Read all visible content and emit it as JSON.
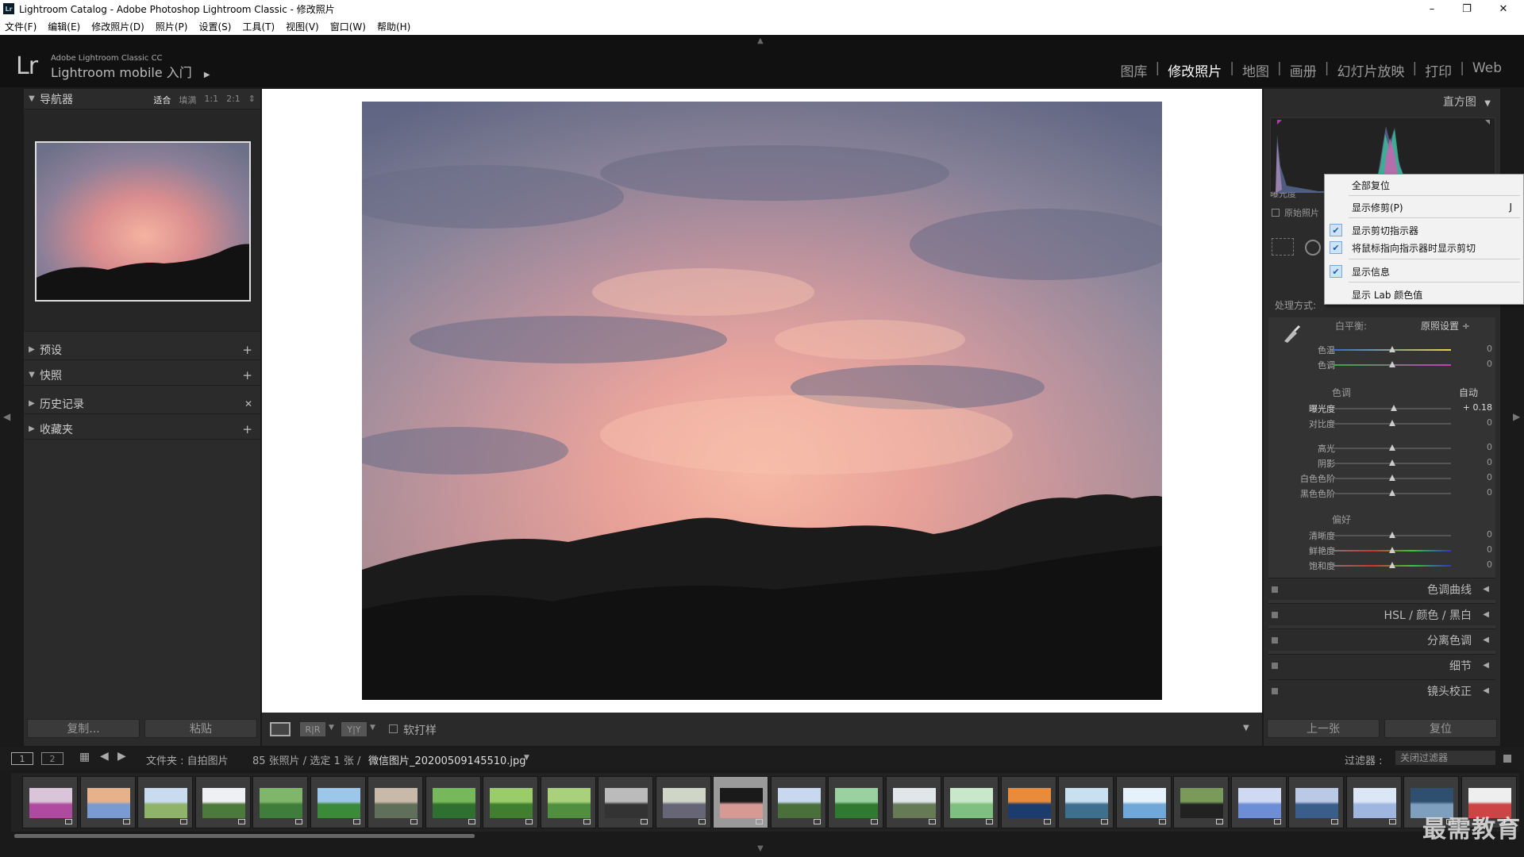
{
  "window": {
    "title": "Lightroom Catalog - Adobe Photoshop Lightroom Classic - 修改照片",
    "badge": "Lr",
    "minimize": "–",
    "restore": "❐",
    "close": "✕"
  },
  "menu": [
    "文件(F)",
    "编辑(E)",
    "修改照片(D)",
    "照片(P)",
    "设置(S)",
    "工具(T)",
    "视图(V)",
    "窗口(W)",
    "帮助(H)"
  ],
  "identity": {
    "logo": "Lr",
    "line1": "Adobe Lightroom Classic CC",
    "line2": "Lightroom mobile 入门",
    "arrow": "▶"
  },
  "modules": {
    "items": [
      "图库",
      "修改照片",
      "地图",
      "画册",
      "幻灯片放映",
      "打印",
      "Web"
    ],
    "active": "修改照片",
    "separator": "|"
  },
  "left_panel": {
    "navigator": {
      "title": "导航器",
      "options": [
        "适合",
        "填满",
        "1:1",
        "2:1"
      ],
      "selected": "适合",
      "spin": "⇕"
    },
    "sections": [
      {
        "title": "预设",
        "action": "+"
      },
      {
        "title": "快照",
        "action": "+"
      },
      {
        "title": "历史记录",
        "action": "✕"
      },
      {
        "title": "收藏夹",
        "action": "+"
      }
    ],
    "copy_button": "复制...",
    "paste_button": "粘贴"
  },
  "toolbar": {
    "soft_proof": "软打样",
    "view_before_after_1": "R|R",
    "view_before_after_2": "Y|Y"
  },
  "right_panel": {
    "histogram_title": "直方图",
    "exposure_label": "曝光度",
    "original_photo": "原始照片",
    "treatment_label": "处理方式:",
    "white_balance": {
      "label": "白平衡:",
      "value": "原照设置 ÷"
    },
    "wb_sliders": [
      {
        "label": "色温",
        "value": "0"
      },
      {
        "label": "色调",
        "value": "0"
      }
    ],
    "tone": {
      "title": "色调",
      "auto": "自动"
    },
    "tone_sliders": [
      {
        "label": "曝光度",
        "value": "+ 0.18"
      },
      {
        "label": "对比度",
        "value": "0"
      },
      {
        "label": "高光",
        "value": "0"
      },
      {
        "label": "阴影",
        "value": "0"
      },
      {
        "label": "白色色阶",
        "value": "0"
      },
      {
        "label": "黑色色阶",
        "value": "0"
      }
    ],
    "presence": {
      "title": "偏好"
    },
    "presence_sliders": [
      {
        "label": "清晰度",
        "value": "0"
      },
      {
        "label": "鲜艳度",
        "value": "0"
      },
      {
        "label": "饱和度",
        "value": "0"
      }
    ],
    "collapsed_panels": [
      "色调曲线",
      "HSL / 颜色 / 黑白",
      "分离色调",
      "细节",
      "镜头校正"
    ],
    "prev_button": "上一张",
    "reset_button": "复位"
  },
  "context_menu": {
    "items": [
      {
        "label": "全部复位",
        "checked": false,
        "shortcut": ""
      },
      {
        "label": "显示修剪(P)",
        "checked": false,
        "shortcut": "J"
      },
      {
        "label": "显示剪切指示器",
        "checked": true,
        "shortcut": ""
      },
      {
        "label": "将鼠标指向指示器时显示剪切",
        "checked": true,
        "shortcut": ""
      },
      {
        "label": "显示信息",
        "checked": true,
        "shortcut": ""
      },
      {
        "label": "显示 Lab 颜色值",
        "checked": false,
        "shortcut": ""
      }
    ]
  },
  "filmstrip": {
    "screen1": "1",
    "screen2": "2",
    "source": "文件夹 : 自拍图片",
    "count": "85 张照片 / 选定 1 张 /",
    "filename": "微信图片_20200509145510.jpg",
    "filter_label": "过滤器 :",
    "filter_value": "关闭过滤器",
    "thumb_count": 26,
    "selected_index": 12
  },
  "watermark": "最需教育",
  "colors": {
    "accent_check": "#1a5fa8",
    "active_module": "#ffffff",
    "panel_bg": "#2b2b2b"
  }
}
